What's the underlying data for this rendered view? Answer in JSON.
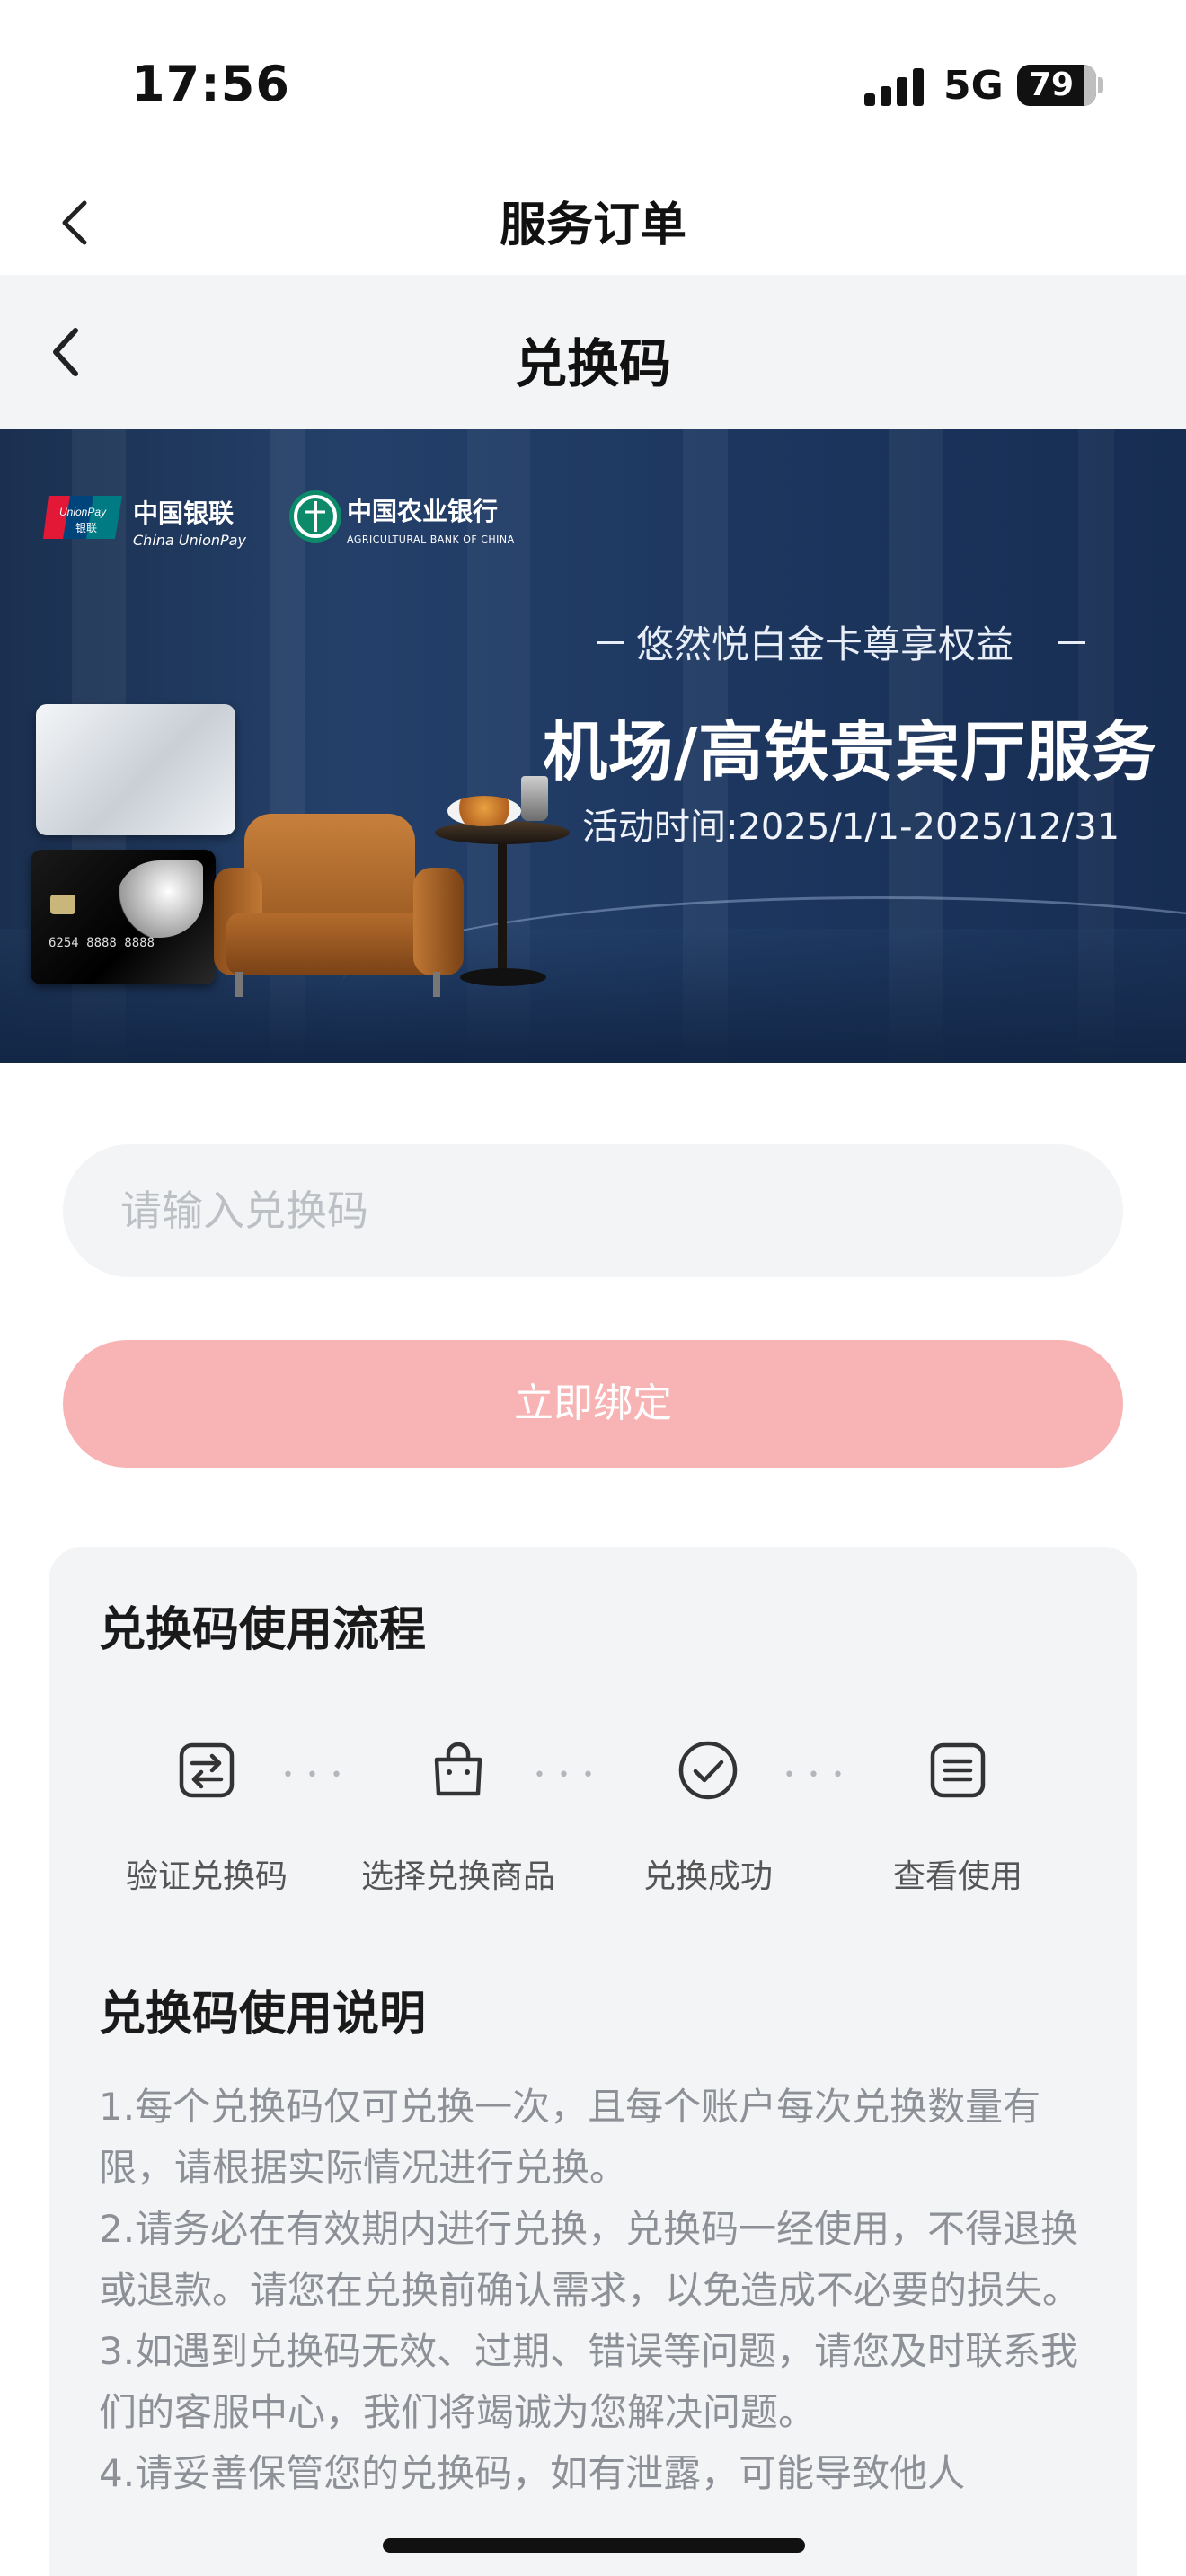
{
  "status_bar": {
    "time": "17:56",
    "network": "5G",
    "battery": "79"
  },
  "nav_outer": {
    "title": "服务订单"
  },
  "nav_inner": {
    "title": "兑换码"
  },
  "banner": {
    "logo_unionpay_cn": "中国银联",
    "logo_unionpay_en": "China UnionPay",
    "logo_abc_cn": "中国农业银行",
    "logo_abc_en": "AGRICULTURAL BANK OF CHINA",
    "subtitle": "悠然悦白金卡尊享权益",
    "title": "机场/高铁贵宾厅服务",
    "date": "活动时间:2025/1/1-2025/12/31",
    "card_number": "6254 8888 8888"
  },
  "form": {
    "input_placeholder": "请输入兑换码",
    "input_value": "",
    "bind_button": "立即绑定"
  },
  "flow": {
    "title": "兑换码使用流程",
    "steps": [
      {
        "label": "验证兑换码",
        "icon": "exchange-icon"
      },
      {
        "label": "选择兑换商品",
        "icon": "shopping-bag-icon"
      },
      {
        "label": "兑换成功",
        "icon": "check-circle-icon"
      },
      {
        "label": "查看使用",
        "icon": "list-icon"
      }
    ]
  },
  "instructions": {
    "title": "兑换码使用说明",
    "items": [
      "1.每个兑换码仅可兑换一次，且每个账户每次兑换数量有限，请根据实际情况进行兑换。",
      "2.请务必在有效期内进行兑换，兑换码一经使用，不得退换或退款。请您在兑换前确认需求，以免造成不必要的损失。",
      "3.如遇到兑换码无效、过期、错误等问题，请您及时联系我们的客服中心，我们将竭诚为您解决问题。",
      "4.请妥善保管您的兑换码，如有泄露，可能导致他人"
    ]
  },
  "colors": {
    "button_disabled": "#f8b4b4",
    "panel_bg": "#f3f4f6",
    "banner_bg": "#1d3760"
  }
}
